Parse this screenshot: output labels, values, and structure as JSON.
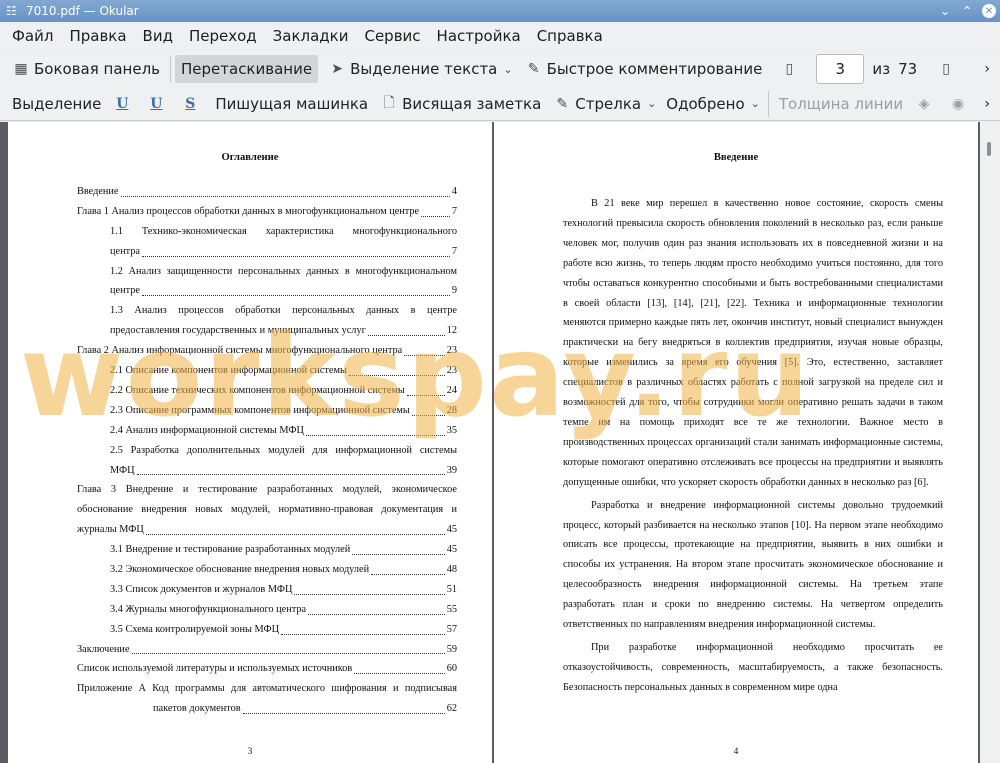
{
  "window": {
    "title": "7010.pdf  — Okular"
  },
  "menu": [
    "Файл",
    "Правка",
    "Вид",
    "Переход",
    "Закладки",
    "Сервис",
    "Настройка",
    "Справка"
  ],
  "toolbar1": {
    "sidebar": "Боковая панель",
    "drag": "Перетаскивание",
    "text_select": "Выделение текста",
    "quick_comment": "Быстрое комментирование",
    "page_current": "3",
    "page_of": "из",
    "page_total": "73"
  },
  "toolbar2": {
    "highlight": "Выделение",
    "typewriter": "Пишущая машинка",
    "note": "Висящая заметка",
    "arrow": "Стрелка",
    "stamp": "Одобрено",
    "line_width": "Толщина линии"
  },
  "left_page": {
    "title": "Оглавление",
    "page_number": "3",
    "toc": [
      {
        "text": "Введение",
        "page": "4"
      },
      {
        "text": "Глава 1 Анализ процессов обработки данных в многофункциональном центре",
        "page": "7"
      },
      {
        "text_l1": "1.1 Технико-экономическая характеристика многофункционального",
        "text_l2": "центра",
        "page": "7"
      },
      {
        "text_l1": "1.2 Анализ защищенности персональных данных в многофункциональном",
        "text_l2": "центре",
        "page": "9"
      },
      {
        "text_l1": "1.3 Анализ процессов обработки персональных данных в центре",
        "text_l2": "предоставления государственных и муниципальных услуг",
        "page": "12"
      },
      {
        "text": "Глава 2 Анализ информационной системы многофункционального центра",
        "page": "23"
      },
      {
        "text": "2.1 Описание компонентов информационной системы",
        "page": "23"
      },
      {
        "text": "2.2 Описание технических компонентов информационной системы",
        "page": "24"
      },
      {
        "text": "2.3 Описание программных компонентов информационной системы",
        "page": "28"
      },
      {
        "text": "2.4 Анализ информационной системы МФЦ",
        "page": "35"
      },
      {
        "text_l1": "2.5 Разработка дополнительных модулей для информационной системы",
        "text_l2": "МФЦ",
        "page": "39"
      },
      {
        "text_l1": "Глава 3 Внедрение и тестирование разработанных модулей, экономическое",
        "text_l2": "обоснование внедрения новых модулей, нормативно-правовая документация и",
        "text_l3": "журналы МФЦ",
        "page": "45"
      },
      {
        "text": "3.1 Внедрение и тестирование разработанных модулей",
        "page": "45"
      },
      {
        "text": "3.2 Экономическое обоснование внедрения новых модулей",
        "page": "48"
      },
      {
        "text": "3.3 Список документов и журналов МФЦ",
        "page": "51"
      },
      {
        "text": "3.4 Журналы многофункционального центра",
        "page": "55"
      },
      {
        "text": "3.5 Схема контролируемой зоны МФЦ",
        "page": "57"
      },
      {
        "text": "Заключение",
        "page": "59"
      },
      {
        "text": "Список используемой литературы и используемых источников",
        "page": "60"
      },
      {
        "text_l1": "Приложение А  Код программы для автоматического шифрования и подписывая",
        "text_l2": "пакетов документов",
        "page": "62"
      }
    ]
  },
  "right_page": {
    "title": "Введение",
    "page_number": "4",
    "paragraphs": [
      "В 21 веке мир перешел в качественно новое состояние, скорость смены технологий превысила скорость обновления поколений в несколько раз, если раньше человек мог, получив один раз знания использовать их в повседневной жизни и на работе всю жизнь, то теперь людям просто необходимо учиться постоянно, для того чтобы оставаться конкурентно способными и быть востребованными специалистами в своей области [13], [14], [21], [22]. Техника и информационные технологии меняются примерно каждые пять лет, окончив институт, новый специалист вынужден практически на бегу внедряться в коллектив предприятия, изучая новые образцы, которые изменились за время его обучения [5]. Это, естественно, заставляет специалистов в различных областях работать с полной загрузкой на пределе сил и возможностей для того, чтобы сотрудники могли оперативно решать задачи в таком темпе им на помощь приходят все те же технологии. Важное место в производственных процессах организаций стали занимать информационные системы, которые помогают оперативно отслеживать все процессы на предприятии и выявлять допущенные ошибки, что ускоряет скорость обработки данных в несколько раз [6].",
      "Разработка и внедрение информационной системы довольно трудоемкий процесс, который разбивается на несколько этапов [10]. На первом этапе необходимо описать все процессы, протекающие на предприятии, выявить в них ошибки и способы их устранения. На втором этапе просчитать экономическое обоснование и целесообразность внедрения информационной системы. На третьем этапе разработать план и сроки по внедрению системы. На четвертом определить ответственных по направлениям внедрения информационной системы.",
      "При разработке информационной необходимо просчитать ее отказоустойчивость, современность, масштабируемость, а также безопасность. Безопасность персональных данных в современном мире одна"
    ]
  },
  "watermark": "workspay.ru"
}
